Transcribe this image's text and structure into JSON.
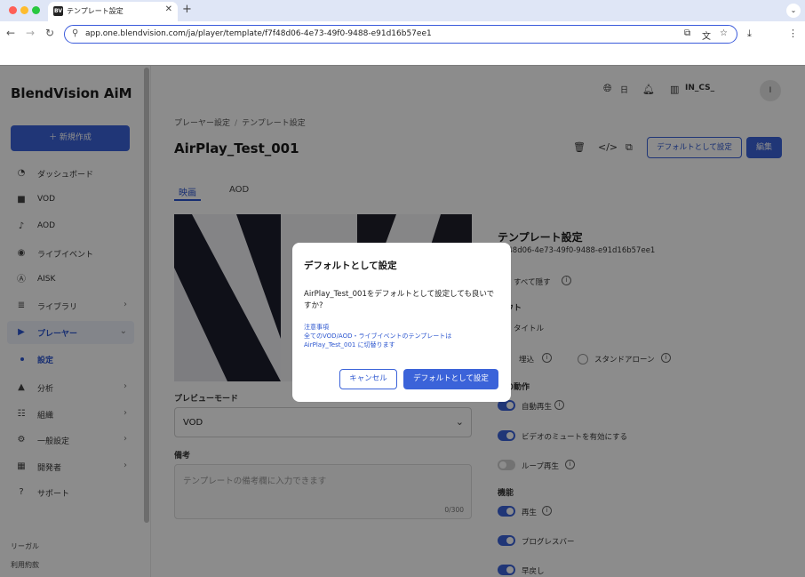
{
  "browser": {
    "tab_title": "テンプレート設定",
    "tab_favicon": "BV",
    "url": "app.one.blendvision.com/ja/player/template/f7f48d06-4e73-49f0-9488-e91d16b57ee1",
    "traffic_colors": [
      "#ff5f57",
      "#febc2e",
      "#28c840"
    ]
  },
  "sidebar": {
    "brand": "BlendVision AiM",
    "new_button": "＋  新規作成",
    "items": [
      {
        "label": "ダッシュボード",
        "icon": "dashboard-icon",
        "glyph": "◔",
        "chevron": false
      },
      {
        "label": "VOD",
        "icon": "video-icon",
        "glyph": "■",
        "chevron": false
      },
      {
        "label": "AOD",
        "icon": "music-note-icon",
        "glyph": "♪",
        "chevron": false
      },
      {
        "label": "ライブイベント",
        "icon": "live-icon",
        "glyph": "◉",
        "chevron": false
      },
      {
        "label": "AISK",
        "icon": "ai-icon",
        "glyph": "Ⓐ",
        "chevron": false
      },
      {
        "label": "ライブラリ",
        "icon": "library-icon",
        "glyph": "≣",
        "chevron": true
      },
      {
        "label": "プレーヤー",
        "icon": "player-icon",
        "glyph": "▶",
        "chevron": true,
        "active": true
      },
      {
        "label": "分析",
        "icon": "analytics-icon",
        "glyph": "▲",
        "chevron": true
      },
      {
        "label": "組織",
        "icon": "organization-icon",
        "glyph": "☷",
        "chevron": true
      },
      {
        "label": "一般設定",
        "icon": "gear-icon",
        "glyph": "⚙",
        "chevron": true
      },
      {
        "label": "開発者",
        "icon": "developer-icon",
        "glyph": "▦",
        "chevron": true
      },
      {
        "label": "サポート",
        "icon": "help-icon",
        "glyph": "?",
        "chevron": false
      }
    ],
    "sub_item": "設定",
    "footer": [
      "リーガル",
      "利用約款"
    ]
  },
  "header": {
    "language": "日",
    "org": "IN_CS_",
    "avatar": "I"
  },
  "page": {
    "breadcrumb": [
      "プレーヤー設定",
      "テンプレート設定"
    ],
    "title": "AirPlay_Test_001",
    "set_default_button": "デフォルトとして設定",
    "edit_button": "編集",
    "tabs": [
      "映画",
      "AOD"
    ],
    "preview_mode_label": "プレビューモード",
    "preview_mode_value": "VOD",
    "notes_label": "備考",
    "notes_placeholder": "テンプレートの備考欄に入力できます",
    "notes_count": "0/300"
  },
  "settings": {
    "title": "テンプレート設定",
    "id": "f7f48d06-4e73-49f0-9488-e91d16b57ee1",
    "hide_all": "すべて隠す",
    "layout_head": "アウト",
    "title_option": "タイトル",
    "embed_option": "埋込",
    "standalone_option": "スタンドアローン",
    "behavior_head": "時の動作",
    "autoplay": "自動再生",
    "mute": "ビデオのミュートを有効にする",
    "loop": "ループ再生",
    "feature_head": "機能",
    "play": "再生",
    "progress": "プログレスバー",
    "rewind": "早戻し"
  },
  "modal": {
    "title": "デフォルトとして設定",
    "body": "AirPlay_Test_001をデフォルトとして設定しても良いですか?",
    "note_title": "注意事項",
    "note_line1": "全てのVOD/AOD・ライブイベントのテンプレートは",
    "note_line2": "AirPlay_Test_001 に切替ります",
    "cancel": "キャンセル",
    "confirm": "デフォルトとして設定"
  }
}
